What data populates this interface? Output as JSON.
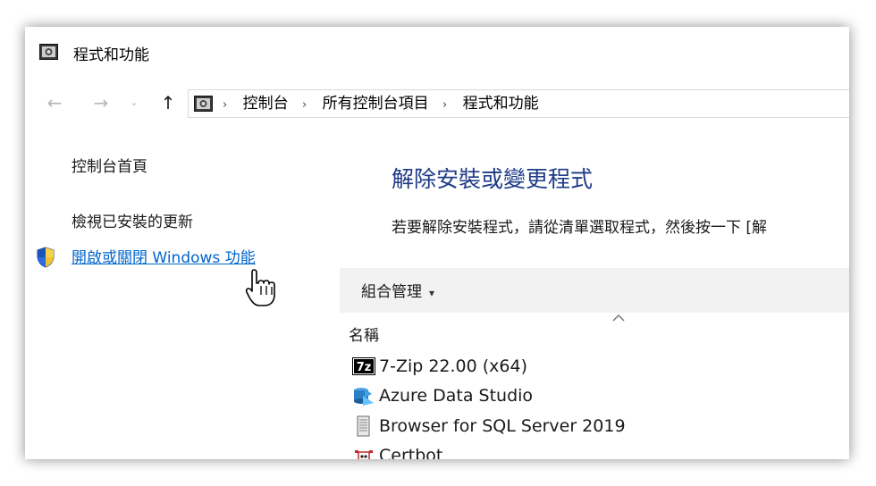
{
  "window": {
    "title": "程式和功能"
  },
  "nav": {
    "back_glyph": "←",
    "forward_glyph": "→",
    "recent_glyph": "⌄",
    "up_glyph": "↑",
    "separator": "›",
    "breadcrumbs": [
      "控制台",
      "所有控制台項目",
      "程式和功能"
    ]
  },
  "left_pane": {
    "home": "控制台首頁",
    "updates": "檢視已安裝的更新",
    "features": "開啟或關閉 Windows 功能"
  },
  "main": {
    "title": "解除安裝或變更程式",
    "instruction": "若要解除安裝程式，請從清單選取程式，然後按一下 [解",
    "organize": "組合管理",
    "organize_caret": "▾",
    "name_column": "名稱",
    "programs": [
      {
        "name": "7-Zip 22.00 (x64)",
        "icon": "7zip-icon"
      },
      {
        "name": "Azure Data Studio",
        "icon": "azure-data-studio-icon"
      },
      {
        "name": "Browser for SQL Server 2019",
        "icon": "sql-browser-icon"
      },
      {
        "name": "Certbot",
        "icon": "certbot-icon"
      }
    ]
  },
  "colors": {
    "link": "#0066cc",
    "title_blue": "#1e3b87",
    "toolbar_bg": "#f2f2f2"
  }
}
